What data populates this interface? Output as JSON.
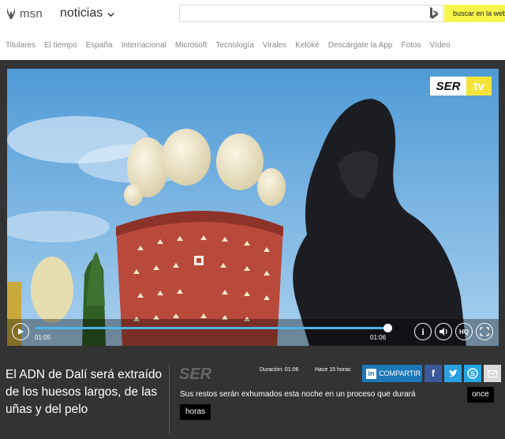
{
  "header": {
    "logo_text": "msn",
    "section": "noticias",
    "search": {
      "value": "",
      "placeholder": ""
    },
    "search_button": "buscar en la web"
  },
  "nav": [
    "Titulares",
    "El tiempo",
    "España",
    "Internacional",
    "Microsoft",
    "Tecnología",
    "Virales",
    "Kelóké",
    "Descárgate la App",
    "Fotos",
    "Vídeo"
  ],
  "video": {
    "badge_ser": "SER",
    "badge_tv": "tv",
    "progress": 0.996,
    "time_current": "01:05",
    "time_total": "01:06",
    "info_label": "i",
    "hq_label": "HQ"
  },
  "article": {
    "headline": "El ADN de Dalí será extraído de los huesos largos, de las uñas y del pelo",
    "source": "SER",
    "duration": "Duración: 01:06",
    "published": "Hace 15 horas",
    "share_label": "COMPARTIR",
    "caption_line1": "Sus restos serán exhumados esta noche en un proceso que durará",
    "caption_word1": "once",
    "caption_word2": "horas"
  },
  "colors": {
    "search_button": "#f5f54a",
    "progress": "#4fb3e6",
    "linkedin": "#1c78b8",
    "facebook": "#3b5998",
    "twitter": "#2ba0e0",
    "skype": "#23a7e6",
    "dark_bg": "#333333"
  }
}
